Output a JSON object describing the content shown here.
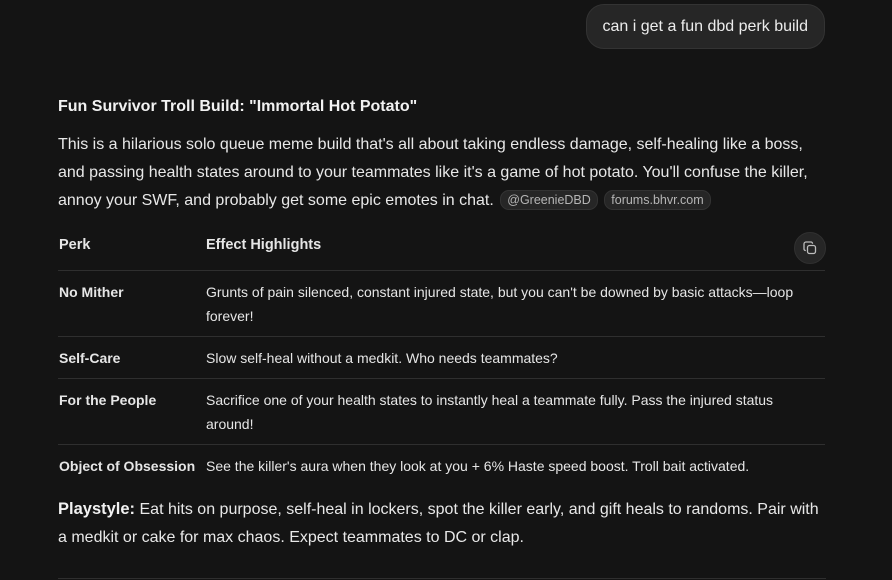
{
  "user_message": "can i get a fun dbd perk build",
  "response": {
    "heading": "Fun Survivor Troll Build: \"Immortal Hot Potato\"",
    "intro": "This is a hilarious solo queue meme build that's all about taking endless damage, self-healing like a boss, and passing health states around to your teammates like it's a game of hot potato. You'll confuse the killer, annoy your SWF, and probably get some epic emotes in chat.",
    "sources": [
      "@GreenieDBD",
      "forums.bhvr.com"
    ],
    "table": {
      "headers": [
        "Perk",
        "Effect Highlights"
      ],
      "rows": [
        {
          "perk": "No Mither",
          "effect": "Grunts of pain silenced, constant injured state, but you can't be downed by basic attacks—loop forever!"
        },
        {
          "perk": "Self-Care",
          "effect": "Slow self-heal without a medkit. Who needs teammates?"
        },
        {
          "perk": "For the People",
          "effect": "Sacrifice one of your health states to instantly heal a teammate fully. Pass the injured status around!"
        },
        {
          "perk": "Object of Obsession",
          "effect": "See the killer's aura when they look at you + 6% Haste speed boost. Troll bait activated."
        }
      ],
      "copy_icon": "copy-icon"
    },
    "playstyle": {
      "label": "Playstyle:",
      "text": " Eat hits on purpose, self-heal in lockers, spot the killer early, and gift heals to randoms. Pair with a medkit or cake for max chaos. Expect teammates to DC or clap."
    }
  }
}
